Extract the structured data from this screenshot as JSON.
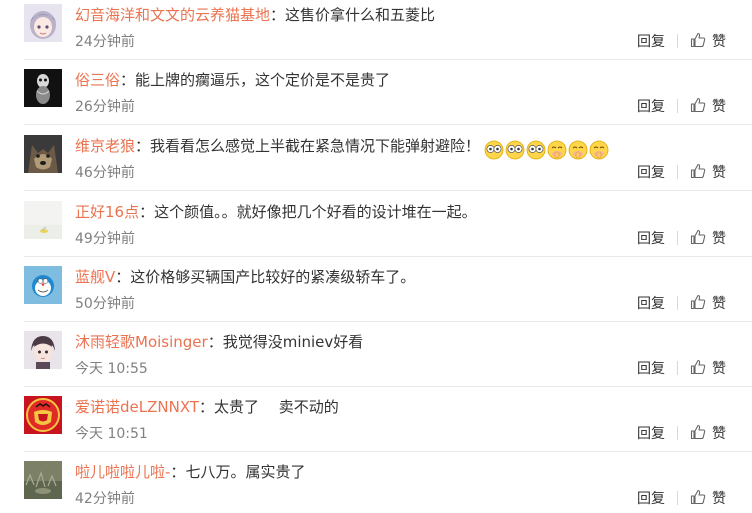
{
  "actions": {
    "reply_label": "回复",
    "like_label": "赞"
  },
  "colors": {
    "username": "#eb7350",
    "time": "#808080",
    "text": "#333333"
  },
  "comments": [
    {
      "username": "幻音海洋和文文的云养猫基地",
      "separator": "：",
      "text": "这售价拿什么和五菱比",
      "time": "24分钟前",
      "avatar": "anime-girl-avatar"
    },
    {
      "username": "俗三俗",
      "separator": "：",
      "text": "能上牌的瘸逼乐，这个定价是不是贵了",
      "time": "26分钟前",
      "avatar": "dark-figure-avatar"
    },
    {
      "username": "维京老狼",
      "separator": "：",
      "text": "我看看怎么感觉上半截在紧急情况下能弹射避险！",
      "time": "46分钟前",
      "avatar": "wolf-avatar",
      "emojis": [
        "eyes-emoji",
        "eyes-emoji",
        "eyes-emoji",
        "hush-emoji",
        "hush-emoji",
        "hush-emoji"
      ]
    },
    {
      "username": "正好16点",
      "separator": "：",
      "text": "这个颜值。。就好像把几个好看的设计堆在一起。",
      "time": "49分钟前",
      "avatar": "light-landscape-avatar"
    },
    {
      "username": "蓝舰V",
      "separator": "：",
      "text": "这价格够买辆国产比较好的紧凑级轿车了。",
      "time": "50分钟前",
      "avatar": "doraemon-avatar"
    },
    {
      "username": "沐雨轻歌Moisinger",
      "separator": "：",
      "text": "我觉得没miniev好看",
      "time": "今天 10:55",
      "avatar": "anime-boy-avatar"
    },
    {
      "username": "爱诺诺deLZNNXT",
      "separator": "：",
      "text": "太贵了　 卖不动的",
      "time": "今天 10:51",
      "avatar": "football-crest-avatar"
    },
    {
      "username": "啦儿啦啦儿啦-",
      "separator": "：",
      "text": "七八万。属实贵了",
      "time": "42分钟前",
      "avatar": "grass-photo-avatar"
    }
  ]
}
